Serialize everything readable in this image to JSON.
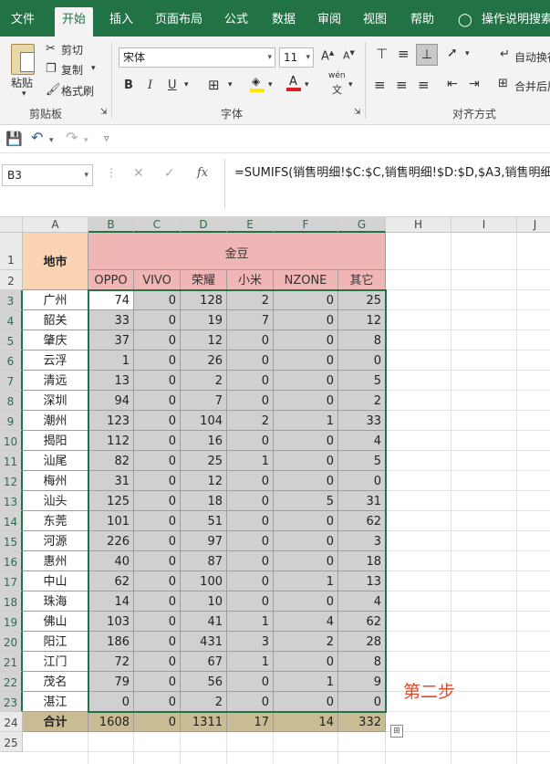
{
  "ribbon_tabs": [
    "文件",
    "开始",
    "插入",
    "页面布局",
    "公式",
    "数据",
    "审阅",
    "视图",
    "帮助"
  ],
  "tell_me": "操作说明搜索",
  "clipboard": {
    "paste": "粘贴",
    "cut": "剪切",
    "copy": "复制",
    "format_painter": "格式刷",
    "group": "剪贴板"
  },
  "font": {
    "name": "宋体",
    "size": "11",
    "group": "字体",
    "bold": "B",
    "italic": "I",
    "underline": "U",
    "phonetic": "wén"
  },
  "alignment": {
    "wrap": "自动换行",
    "merge": "合并后居",
    "group": "对齐方式"
  },
  "name_box": "B3",
  "formula": "=SUMIFS(销售明细!$C:$C,销售明细!$D:$D,$A3,销售明细",
  "fx": "fx",
  "col_letters": [
    "A",
    "B",
    "C",
    "D",
    "E",
    "F",
    "G",
    "H",
    "I",
    "J"
  ],
  "sheet": {
    "region_header": "地市",
    "group_header": "金豆",
    "brands": [
      "OPPO",
      "VIVO",
      "荣耀",
      "小米",
      "NZONE",
      "其它"
    ],
    "rows": [
      {
        "city": "广州",
        "v": [
          74,
          0,
          128,
          2,
          0,
          25
        ]
      },
      {
        "city": "韶关",
        "v": [
          33,
          0,
          19,
          7,
          0,
          12
        ]
      },
      {
        "city": "肇庆",
        "v": [
          37,
          0,
          12,
          0,
          0,
          8
        ]
      },
      {
        "city": "云浮",
        "v": [
          1,
          0,
          26,
          0,
          0,
          0
        ]
      },
      {
        "city": "清远",
        "v": [
          13,
          0,
          2,
          0,
          0,
          5
        ]
      },
      {
        "city": "深圳",
        "v": [
          94,
          0,
          7,
          0,
          0,
          2
        ]
      },
      {
        "city": "潮州",
        "v": [
          123,
          0,
          104,
          2,
          1,
          33
        ]
      },
      {
        "city": "揭阳",
        "v": [
          112,
          0,
          16,
          0,
          0,
          4
        ]
      },
      {
        "city": "汕尾",
        "v": [
          82,
          0,
          25,
          1,
          0,
          5
        ]
      },
      {
        "city": "梅州",
        "v": [
          31,
          0,
          12,
          0,
          0,
          0
        ]
      },
      {
        "city": "汕头",
        "v": [
          125,
          0,
          18,
          0,
          5,
          31
        ]
      },
      {
        "city": "东莞",
        "v": [
          101,
          0,
          51,
          0,
          0,
          62
        ]
      },
      {
        "city": "河源",
        "v": [
          226,
          0,
          97,
          0,
          0,
          3
        ]
      },
      {
        "city": "惠州",
        "v": [
          40,
          0,
          87,
          0,
          0,
          18
        ]
      },
      {
        "city": "中山",
        "v": [
          62,
          0,
          100,
          0,
          1,
          13
        ]
      },
      {
        "city": "珠海",
        "v": [
          14,
          0,
          10,
          0,
          0,
          4
        ]
      },
      {
        "city": "佛山",
        "v": [
          103,
          0,
          41,
          1,
          4,
          62
        ]
      },
      {
        "city": "阳江",
        "v": [
          186,
          0,
          431,
          3,
          2,
          28
        ]
      },
      {
        "city": "江门",
        "v": [
          72,
          0,
          67,
          1,
          0,
          8
        ]
      },
      {
        "city": "茂名",
        "v": [
          79,
          0,
          56,
          0,
          1,
          9
        ]
      },
      {
        "city": "湛江",
        "v": [
          0,
          0,
          2,
          0,
          0,
          0
        ]
      }
    ],
    "total_label": "合计",
    "totals": [
      1608,
      0,
      1311,
      17,
      14,
      332
    ],
    "row_numbers": [
      "1",
      "2",
      "3",
      "4",
      "5",
      "6",
      "7",
      "8",
      "9",
      "10",
      "11",
      "12",
      "13",
      "14",
      "15",
      "16",
      "17",
      "18",
      "19",
      "20",
      "21",
      "22",
      "23",
      "24",
      "25"
    ]
  },
  "annotation": "第二步",
  "colors": {
    "excel_green": "#217346",
    "brand_header": "#f0b5b5",
    "region_header": "#fbd4b4",
    "total_row": "#c9bc94",
    "selected_range": "#d0d0d0",
    "annotation": "#e04a2a"
  }
}
